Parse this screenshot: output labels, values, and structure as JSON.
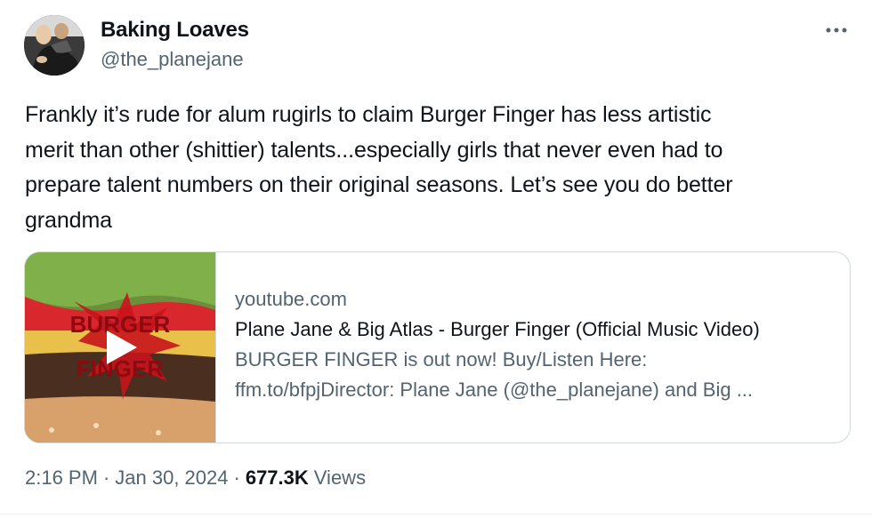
{
  "user": {
    "display_name": "Baking Loaves",
    "handle": "@the_planejane",
    "avatar_icon": "avatar-photo"
  },
  "more_icon": "more-horizontal-icon",
  "tweet": {
    "lines": [
      "Frankly it’s rude for alum rugirls to claim Burger Finger has less artistic",
      "merit than other (shittier) talents...especially girls that never even had to",
      "prepare talent numbers on their original seasons. Let’s see you do better",
      "grandma"
    ]
  },
  "card": {
    "domain": "youtube.com",
    "title": "Plane Jane & Big Atlas - Burger Finger (Official Music Video)",
    "description_line1": "BURGER FINGER is out now! Buy/Listen Here:",
    "description_line2": "ffm.to/bfpjDirector: Plane Jane (@the_planejane) and Big ...",
    "thumbnail_icon": "video-thumbnail",
    "play_icon": "play-icon",
    "thumbnail_text": "BURGER FINGER"
  },
  "meta": {
    "time": "2:16 PM",
    "separator": "·",
    "date": "Jan 30, 2024",
    "views_count": "677.3K",
    "views_label": "Views"
  },
  "colors": {
    "text_primary": "#0f1419",
    "text_secondary": "#536471",
    "border": "#cfd9de"
  }
}
